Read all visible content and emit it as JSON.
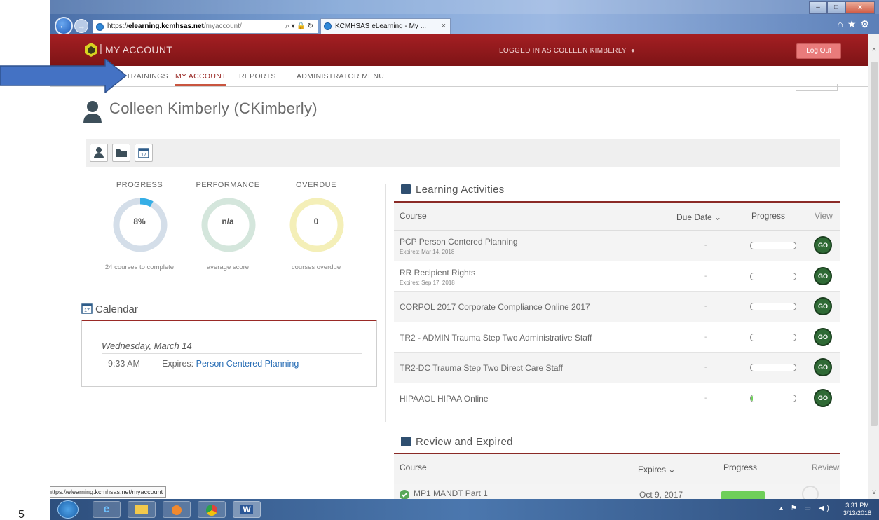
{
  "browser": {
    "url_prefix": "https://",
    "url_host": "elearning.kcmhsas.net",
    "url_path": "/myaccount/",
    "address_tools": "⌕ ▾ 🔒 ↻",
    "tab_title": "KCMHSAS eLearning - My ...",
    "tab_close": "×",
    "min": "–",
    "max": "□",
    "close": "x",
    "right_tools": "⌂★⚙"
  },
  "header": {
    "title": "MY ACCOUNT",
    "logged_in": "LOGGED IN AS COLLEEN KIMBERLY",
    "logout": "Log Out"
  },
  "nav": {
    "trainings": "TRAININGS",
    "my_account": "MY ACCOUNT",
    "reports": "REPORTS",
    "admin": "ADMINISTRATOR MENU"
  },
  "profile": {
    "name": "Colleen Kimberly (CKimberly)"
  },
  "stats": {
    "progress": {
      "title": "PROGRESS",
      "value": "8%",
      "sub": "24 courses to complete",
      "fraction": 0.08
    },
    "performance": {
      "title": "PERFORMANCE",
      "value": "n/a",
      "sub": "average score"
    },
    "overdue": {
      "title": "OVERDUE",
      "value": "0",
      "sub": "courses overdue"
    }
  },
  "calendar": {
    "heading": "Calendar",
    "icon_day": "17",
    "date": "Wednesday, March 14",
    "time": "9:33 AM",
    "expires_label": "Expires:",
    "expires_course": "Person Centered Planning"
  },
  "learning": {
    "title": "Learning Activities",
    "col_course": "Course",
    "col_due": "Due Date",
    "col_progress": "Progress",
    "col_view": "View",
    "go_label": "GO",
    "rows": [
      {
        "name": "PCP Person Centered Planning",
        "expires": "Expires: Mar 14, 2018",
        "due": "-",
        "progress": 0
      },
      {
        "name": "RR Recipient Rights",
        "expires": "Expires: Sep 17, 2018",
        "due": "-",
        "progress": 0
      },
      {
        "name": "CORPOL 2017 Corporate Compliance Online 2017",
        "expires": "",
        "due": "-",
        "progress": 0
      },
      {
        "name": "TR2 - ADMIN Trauma Step Two Administrative Staff",
        "expires": "",
        "due": "-",
        "progress": 0
      },
      {
        "name": "TR2-DC Trauma Step Two Direct Care Staff",
        "expires": "",
        "due": "-",
        "progress": 0
      },
      {
        "name": "HIPAAOL HIPAA Online",
        "expires": "",
        "due": "-",
        "progress": 0.03
      }
    ]
  },
  "review": {
    "title": "Review and Expired",
    "col_course": "Course",
    "col_expires": "Expires",
    "col_progress": "Progress",
    "col_review": "Review",
    "rows": [
      {
        "name": "MP1 MANDT Part 1",
        "expires": "Oct 9, 2017",
        "progress": 1
      }
    ]
  },
  "status_tip": "https://elearning.kcmhsas.net/myaccount",
  "taskbar": {
    "word": "W",
    "tray": "▴ ⚑ ▭ ◀)",
    "time": "3:31 PM",
    "date": "3/13/2018"
  },
  "margin_number": "5",
  "colors": {
    "header_red": "#8f1a1c",
    "accent_link": "#2a6fb6",
    "progress_ring": "#35aee6",
    "overdue_ring": "#f4efb8",
    "performance_ring": "#d4e6dc"
  }
}
